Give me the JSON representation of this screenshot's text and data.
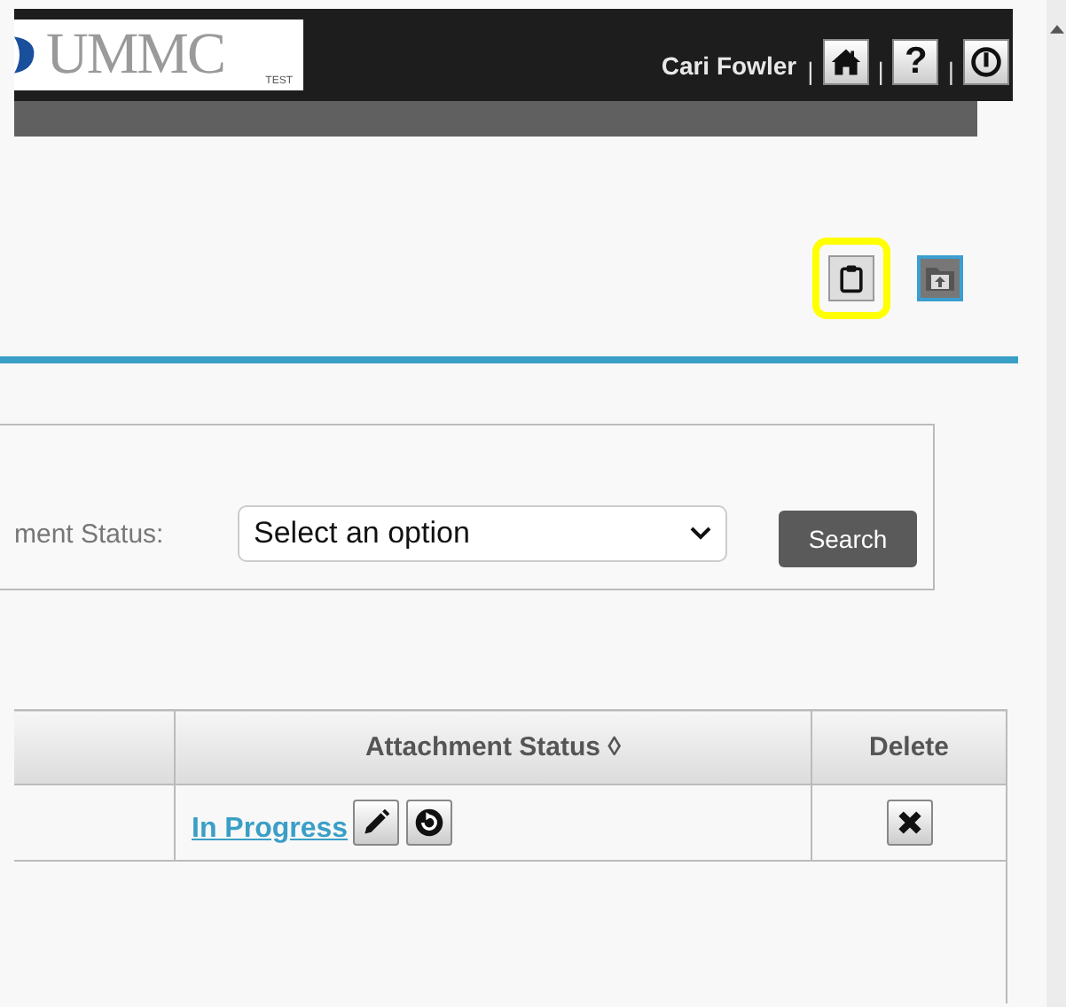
{
  "header": {
    "logo": {
      "wordmark": "UMMC",
      "tag": "TEST"
    },
    "user_name": "Cari Fowler",
    "separator": "|",
    "nav_buttons": [
      {
        "kind": "home"
      },
      {
        "kind": "help",
        "label": "?"
      },
      {
        "kind": "power"
      }
    ]
  },
  "toolbar": {
    "buttons": [
      {
        "kind": "clipboard",
        "highlighted": true,
        "focused": false
      },
      {
        "kind": "folder-upload",
        "highlighted": false,
        "focused": true
      }
    ]
  },
  "search_panel": {
    "field_label": "ment Status:",
    "select": {
      "value": "Select an option"
    },
    "button": "Search"
  },
  "table": {
    "columns": [
      {
        "label": "Attachment Status ◊"
      },
      {
        "label": "Delete"
      }
    ],
    "rows": [
      {
        "status": "In Progress",
        "actions": [
          {
            "kind": "edit"
          },
          {
            "kind": "reset"
          }
        ]
      }
    ]
  }
}
